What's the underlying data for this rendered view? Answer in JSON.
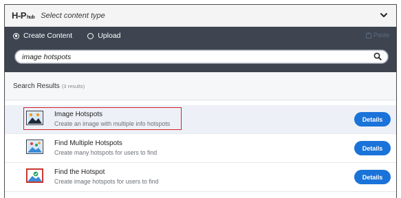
{
  "header": {
    "logo_main": "H-P",
    "logo_sub": "hub",
    "title": "Select content type"
  },
  "tabs": {
    "create_label": "Create Content",
    "upload_label": "Upload",
    "paste_label": "Paste",
    "selected": "create"
  },
  "search": {
    "value": "image hotspots",
    "placeholder": ""
  },
  "results": {
    "label": "Search Results",
    "count": "(3 results)",
    "details_label": "Details",
    "items": [
      {
        "title": "Image Hotspots",
        "description": "Create an image with multiple info hotspots",
        "icon": "image-hotspots-icon"
      },
      {
        "title": "Find Multiple Hotspots",
        "description": "Create many hotspots for users to find",
        "icon": "find-multiple-hotspots-icon"
      },
      {
        "title": "Find the Hotspot",
        "description": "Create image hotspots for users to find",
        "icon": "find-the-hotspot-icon"
      }
    ]
  },
  "colors": {
    "accent": "#1a73d9",
    "toolbar": "#3e4550",
    "highlight": "#d2222a"
  }
}
